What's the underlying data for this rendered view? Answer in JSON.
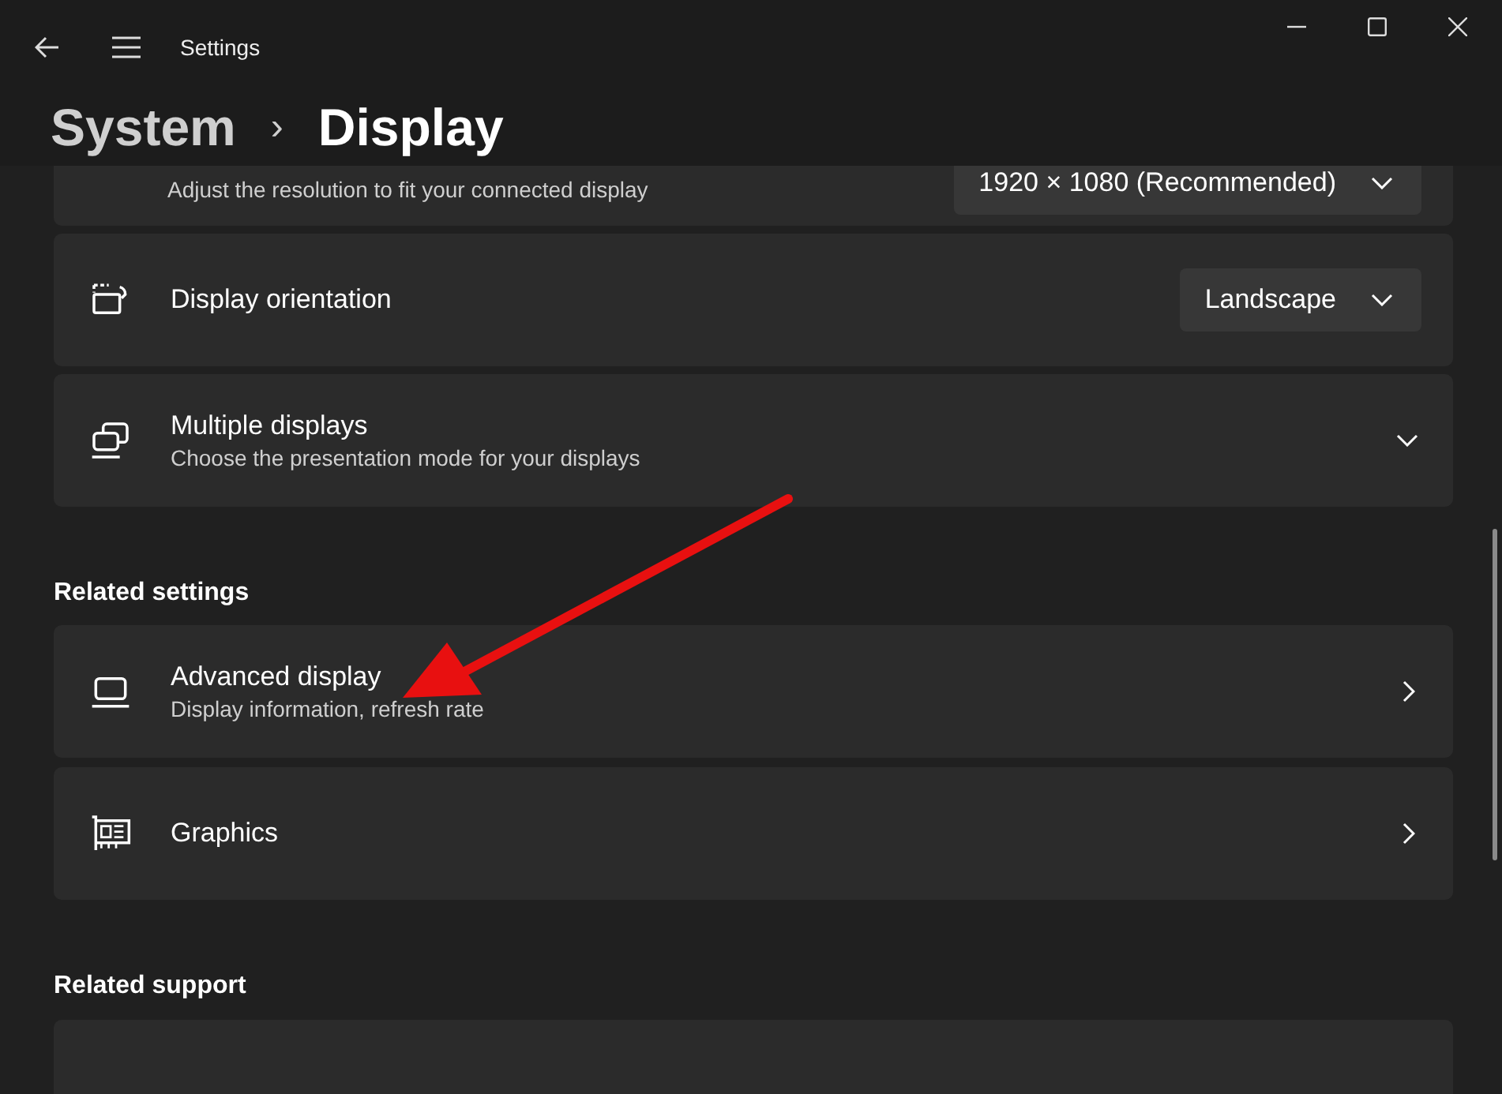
{
  "window": {
    "title": "Settings"
  },
  "breadcrumb": {
    "parent": "System",
    "separator": "›",
    "current": "Display"
  },
  "cards": [
    {
      "kind": "dropdown",
      "subtitle": "Adjust the resolution to fit your connected display",
      "value": "1920 × 1080 (Recommended)"
    },
    {
      "kind": "dropdown",
      "title": "Display orientation",
      "value": "Landscape"
    },
    {
      "kind": "expander",
      "title": "Multiple displays",
      "subtitle": "Choose the presentation mode for your displays",
      "expanded": false
    }
  ],
  "sections": [
    {
      "heading": "Related settings",
      "items": [
        {
          "kind": "link",
          "title": "Advanced display",
          "subtitle": "Display information, refresh rate"
        },
        {
          "kind": "link",
          "title": "Graphics"
        }
      ]
    },
    {
      "heading": "Related support",
      "items": [
        {
          "kind": "blank"
        }
      ]
    }
  ]
}
